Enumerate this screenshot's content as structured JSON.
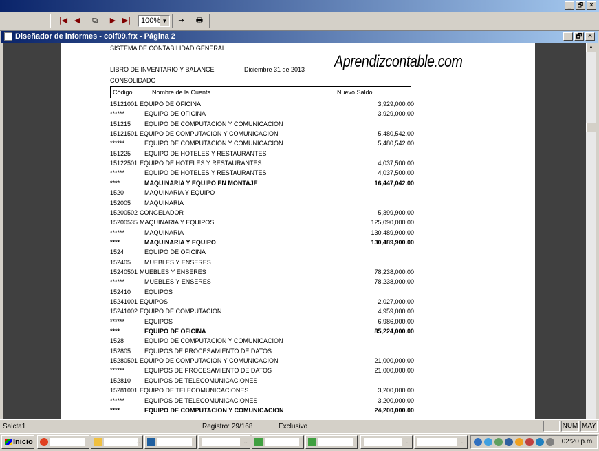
{
  "window": {
    "title": "Diseñador de informes - coif09.frx - Página 2",
    "controls": {
      "minimize": "_",
      "maximize": "🗗",
      "close": "✕"
    }
  },
  "toolbar": {
    "zoom_value": "100%",
    "buttons": {
      "first_page": "first-page-icon",
      "prev_page": "prev-page-icon",
      "go_to_page": "go-to-page-icon",
      "next_page": "next-page-icon",
      "last_page": "last-page-icon",
      "close_preview": "close-preview-icon",
      "print": "print-icon"
    }
  },
  "report": {
    "system_title": "SISTEMA DE CONTABILIDAD GENERAL",
    "book_title": "LIBRO DE INVENTARIO Y BALANCE",
    "date": "Diciembre 31 de 2013",
    "scope": "CONSOLIDADO",
    "watermark": "Aprendizcontable.com",
    "columns": {
      "code": "Código",
      "name": "Nombre de la Cuenta",
      "balance": "Nuevo Saldo"
    },
    "rows": [
      {
        "code": "15121001",
        "name": "EQUIPO DE OFICINA",
        "amount": "3,929,000.00",
        "bold": false,
        "inline": true
      },
      {
        "code": "******",
        "name": "EQUIPO DE OFICINA",
        "amount": "3,929,000.00",
        "bold": false,
        "inline": false
      },
      {
        "code": "151215",
        "name": "EQUIPO DE COMPUTACION Y COMUNICACION",
        "amount": "",
        "bold": false,
        "inline": false
      },
      {
        "code": "15121501",
        "name": "EQUIPO DE COMPUTACION Y COMUNICACION",
        "amount": "5,480,542.00",
        "bold": false,
        "inline": true
      },
      {
        "code": "******",
        "name": "EQUIPO DE COMPUTACION Y COMUNICACION",
        "amount": "5,480,542.00",
        "bold": false,
        "inline": false
      },
      {
        "code": "151225",
        "name": "EQUIPO DE HOTELES Y RESTAURANTES",
        "amount": "",
        "bold": false,
        "inline": false
      },
      {
        "code": "15122501",
        "name": "EQUIPO DE HOTELES Y RESTAURANTES",
        "amount": "4,037,500.00",
        "bold": false,
        "inline": true
      },
      {
        "code": "******",
        "name": "EQUIPO DE HOTELES Y RESTAURANTES",
        "amount": "4,037,500.00",
        "bold": false,
        "inline": false
      },
      {
        "code": "****",
        "name": "MAQUINARIA Y EQUIPO EN MONTAJE",
        "amount": "16,447,042.00",
        "bold": true,
        "inline": false
      },
      {
        "code": "1520",
        "name": "MAQUINARIA Y EQUIPO",
        "amount": "",
        "bold": false,
        "inline": false
      },
      {
        "code": "152005",
        "name": "MAQUINARIA",
        "amount": "",
        "bold": false,
        "inline": false
      },
      {
        "code": "15200502",
        "name": "CONGELADOR",
        "amount": "5,399,900.00",
        "bold": false,
        "inline": true
      },
      {
        "code": "15200535",
        "name": "MAQUINARIA Y EQUIPOS",
        "amount": "125,090,000.00",
        "bold": false,
        "inline": true
      },
      {
        "code": "******",
        "name": "MAQUINARIA",
        "amount": "130,489,900.00",
        "bold": false,
        "inline": false
      },
      {
        "code": "****",
        "name": "MAQUINARIA Y EQUIPO",
        "amount": "130,489,900.00",
        "bold": true,
        "inline": false
      },
      {
        "code": "1524",
        "name": "EQUIPO DE OFICINA",
        "amount": "",
        "bold": false,
        "inline": false
      },
      {
        "code": "152405",
        "name": "MUEBLES Y ENSERES",
        "amount": "",
        "bold": false,
        "inline": false
      },
      {
        "code": "15240501",
        "name": "MUEBLES Y ENSERES",
        "amount": "78,238,000.00",
        "bold": false,
        "inline": true
      },
      {
        "code": "******",
        "name": "MUEBLES Y ENSERES",
        "amount": "78,238,000.00",
        "bold": false,
        "inline": false
      },
      {
        "code": "152410",
        "name": "EQUIPOS",
        "amount": "",
        "bold": false,
        "inline": false
      },
      {
        "code": "15241001",
        "name": "EQUIPOS",
        "amount": "2,027,000.00",
        "bold": false,
        "inline": true
      },
      {
        "code": "15241002",
        "name": "EQUIPO DE COMPUTACION",
        "amount": "4,959,000.00",
        "bold": false,
        "inline": true
      },
      {
        "code": "******",
        "name": "EQUIPOS",
        "amount": "6,986,000.00",
        "bold": false,
        "inline": false
      },
      {
        "code": "****",
        "name": "EQUIPO DE OFICINA",
        "amount": "85,224,000.00",
        "bold": true,
        "inline": false
      },
      {
        "code": "1528",
        "name": "EQUIPO DE COMPUTACION Y COMUNICACION",
        "amount": "",
        "bold": false,
        "inline": false
      },
      {
        "code": "152805",
        "name": "EQUIPOS DE PROCESAMIENTO DE DATOS",
        "amount": "",
        "bold": false,
        "inline": false
      },
      {
        "code": "15280501",
        "name": "EQUIPO DE COMPUTACION Y COMUNICACION",
        "amount": "21,000,000.00",
        "bold": false,
        "inline": true
      },
      {
        "code": "******",
        "name": "EQUIPOS DE PROCESAMIENTO DE DATOS",
        "amount": "21,000,000.00",
        "bold": false,
        "inline": false
      },
      {
        "code": "152810",
        "name": "EQUIPOS DE TELECOMUNICACIONES",
        "amount": "",
        "bold": false,
        "inline": false
      },
      {
        "code": "15281001",
        "name": "EQUIPO DE TELECOMUNICACIONES",
        "amount": "3,200,000.00",
        "bold": false,
        "inline": true
      },
      {
        "code": "******",
        "name": "EQUIPOS DE TELECOMUNICACIONES",
        "amount": "3,200,000.00",
        "bold": false,
        "inline": false
      },
      {
        "code": "****",
        "name": "EQUIPO DE COMPUTACION Y COMUNICACION",
        "amount": "24,200,000.00",
        "bold": true,
        "inline": false
      }
    ]
  },
  "statusbar": {
    "table": "Salcta1",
    "record": "Registro: 29/168",
    "mode": "Exclusivo",
    "num": "NUM",
    "caps": "MAY"
  },
  "taskbar": {
    "start": "Inicio",
    "clock": "02:20 p.m."
  }
}
